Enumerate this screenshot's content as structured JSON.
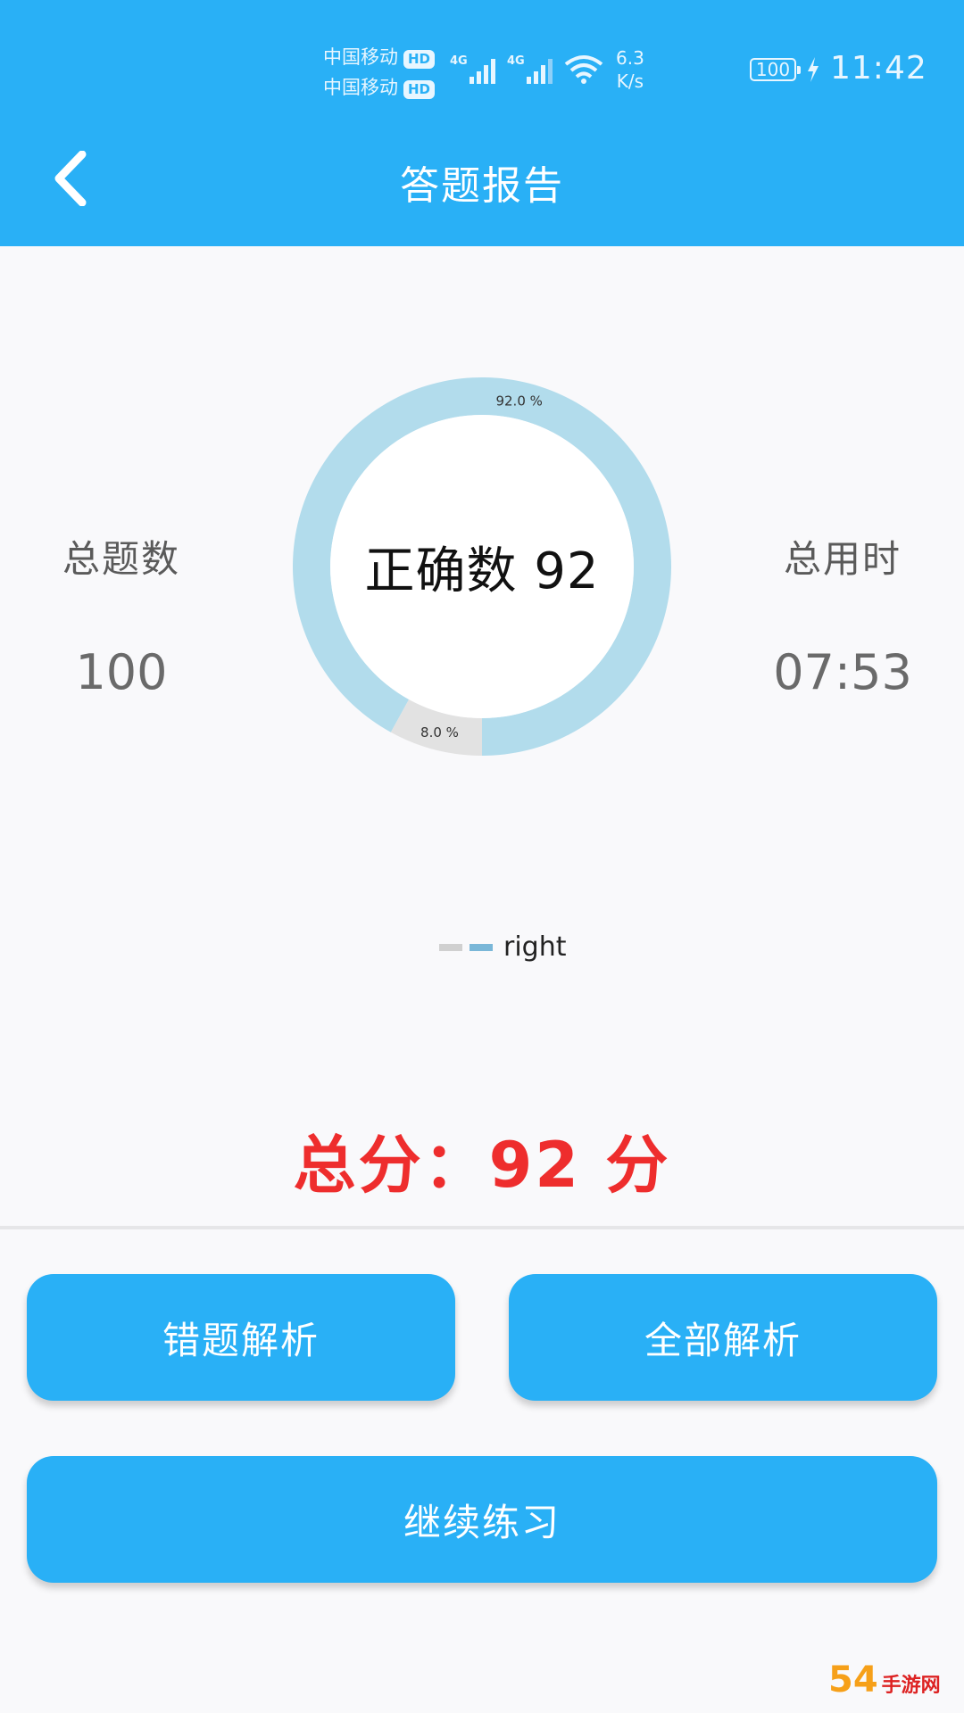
{
  "status_bar": {
    "carrier1": "中国移动",
    "carrier2": "中国移动",
    "hd": "HD",
    "network": "4G",
    "speed_value": "6.3",
    "speed_unit": "K/s",
    "battery": "100",
    "time": "11:42"
  },
  "header": {
    "title": "答题报告",
    "back_icon": "chevron-left-icon"
  },
  "stats": {
    "total_label": "总题数",
    "total_value": "100",
    "time_label": "总用时",
    "time_value": "07:53"
  },
  "chart_data": {
    "type": "pie",
    "center_text": "正确数 92",
    "slices": [
      {
        "label": "92.0 %",
        "value": 92.0,
        "color": "#b2dcec"
      },
      {
        "label": "8.0 %",
        "value": 8.0,
        "color": "#e2e2e2"
      }
    ],
    "legend": [
      "right"
    ],
    "legend_swatch_colors": [
      "#d0d0d0",
      "#7ab7d8"
    ],
    "legend_placement": "bottom-center"
  },
  "score": {
    "text": "总分：92 分"
  },
  "buttons": {
    "wrong_analysis": "错题解析",
    "all_analysis": "全部解析",
    "continue": "继续练习"
  },
  "watermark": {
    "brand": "54",
    "sub": "手游网"
  },
  "colors": {
    "primary": "#29b0f6",
    "score_red": "#ee2d2d"
  }
}
